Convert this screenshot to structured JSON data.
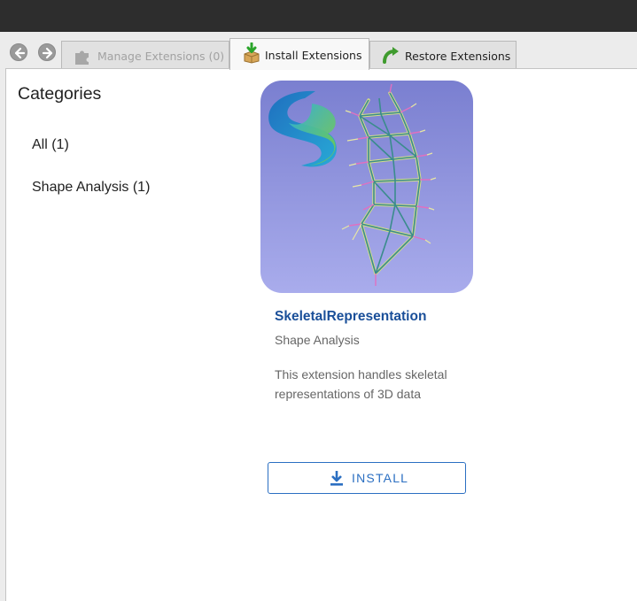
{
  "window": {
    "title": ""
  },
  "toolbar": {
    "back_icon": "arrow-left-icon",
    "forward_icon": "arrow-right-icon",
    "tabs": [
      {
        "label": "Manage Extensions (0)",
        "icon": "puzzle-piece-icon",
        "state": "disabled"
      },
      {
        "label": "Install Extensions",
        "icon": "package-download-icon",
        "state": "active"
      },
      {
        "label": "Restore Extensions",
        "icon": "restore-arrow-icon",
        "state": "normal"
      }
    ]
  },
  "sidebar": {
    "title": "Categories",
    "items": [
      {
        "label": "All (1)"
      },
      {
        "label": "Shape Analysis (1)"
      }
    ]
  },
  "extension": {
    "name": "SkeletalRepresentation",
    "category": "Shape Analysis",
    "description": "This extension handles skeletal representations of 3D data",
    "install_label": "INSTALL",
    "install_icon": "download-icon"
  },
  "colors": {
    "link": "#1a4f99",
    "accent": "#2b6fc2",
    "thumbnail_bg": "#8a8fd6"
  }
}
